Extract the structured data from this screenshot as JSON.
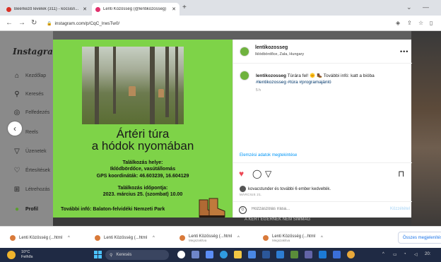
{
  "browser": {
    "tabs": [
      {
        "title": "Beérkező levelek (311) - kocsisn...",
        "close": "✕",
        "color": "#d93025"
      },
      {
        "title": "Lenti Közösség (@lentikozosseg)",
        "close": "✕",
        "color": "#e1306c"
      }
    ],
    "new_tab": "+",
    "url": "instagram.com/p/CqC_lrwsTw0/"
  },
  "instagram": {
    "logo": "Instagram",
    "sidebar": [
      {
        "label": "Kezdőlap",
        "icon": "⌂"
      },
      {
        "label": "Keresés",
        "icon": "⚲"
      },
      {
        "label": "Felfedezés",
        "icon": "◎"
      },
      {
        "label": "Reels",
        "icon": "▶"
      },
      {
        "label": "Üzenetek",
        "icon": "▽"
      },
      {
        "label": "Értesítések",
        "icon": "♡"
      },
      {
        "label": "Létrehozás",
        "icon": "⊞"
      },
      {
        "label": "Profil",
        "icon": "●"
      }
    ]
  },
  "post": {
    "image": {
      "title_line1": "Ártéri túra",
      "title_line2": "a hódok nyomában",
      "meet_label": "Találkozás helye:",
      "meet_place": "Iklódbördőce, vasútállomás",
      "gps": "GPS koordináták: 46.603239, 16.604129",
      "time_label": "Találkozás időpontja:",
      "time_value": "2023. március 25. (szombat) 10.00",
      "more_info": "További infó: Balaton-felvidéki Nemzeti Park"
    },
    "author": "lentikozosseg",
    "location": "Iklódbördőce, Zala, Hungary",
    "caption_text": "Túrára fel! 🌞 🥾 További infó: katt a bióba",
    "hashtags": "#lentikozosseg #túra #programajánló",
    "caption_age": "5 h",
    "insights": "Elemzési adatok megtekintése",
    "likes_text": "kovacstunder és további 6 ember kedvelték.",
    "date": "MÁRCIUS 21.",
    "comment_placeholder": "Hozzászólás írása...",
    "post_button": "Közzététel",
    "background_banner": "A KERT EGERNEK NEM SIMMAG"
  },
  "downloads": [
    {
      "name": "Lenti Közösség (...html",
      "sub": "",
      "chev": "^"
    },
    {
      "name": "Lenti Közösség (...html",
      "sub": "",
      "chev": "^"
    },
    {
      "name": "Lenti Közösség (...html",
      "sub": "Megszakítva",
      "chev": "^"
    },
    {
      "name": "Lenti Közösség (...html",
      "sub": "Megszakítva",
      "chev": "^"
    }
  ],
  "show_all": "Összes megjelenítése",
  "taskbar": {
    "temp": "10°C",
    "weather": "Felhős",
    "search": "Keresés",
    "time": "20:"
  }
}
